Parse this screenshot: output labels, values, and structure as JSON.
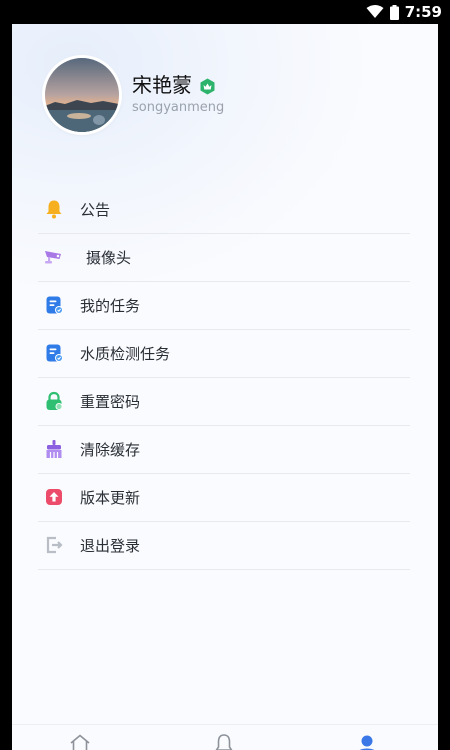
{
  "status_bar": {
    "time": "7:59",
    "icons": [
      "wifi-icon",
      "battery-icon"
    ]
  },
  "profile": {
    "name": "宋艳蒙",
    "username": "songyanmeng",
    "verified_badge_color": "#2db36b"
  },
  "menu": {
    "items": [
      {
        "label": "公告",
        "icon": "bell-icon",
        "color": "#f6b01f"
      },
      {
        "label": "摄像头",
        "icon": "camera-icon",
        "color": "#a878e6"
      },
      {
        "label": "我的任务",
        "icon": "task-icon",
        "color": "#2f7be8"
      },
      {
        "label": "水质检测任务",
        "icon": "water-task-icon",
        "color": "#2f7be8"
      },
      {
        "label": "重置密码",
        "icon": "lock-icon",
        "color": "#2fbf72"
      },
      {
        "label": "清除缓存",
        "icon": "brush-icon",
        "color": "#8a5fe0"
      },
      {
        "label": "版本更新",
        "icon": "update-icon",
        "color": "#ec4c6a"
      },
      {
        "label": "退出登录",
        "icon": "logout-icon",
        "color": "#b9bec6"
      }
    ]
  },
  "tabbar": {
    "tabs": [
      {
        "icon": "home-icon",
        "active": false
      },
      {
        "icon": "bell-outline-icon",
        "active": false
      },
      {
        "icon": "profile-icon",
        "active": true
      }
    ],
    "active_color": "#3b78e7",
    "inactive_color": "#8d929a"
  }
}
